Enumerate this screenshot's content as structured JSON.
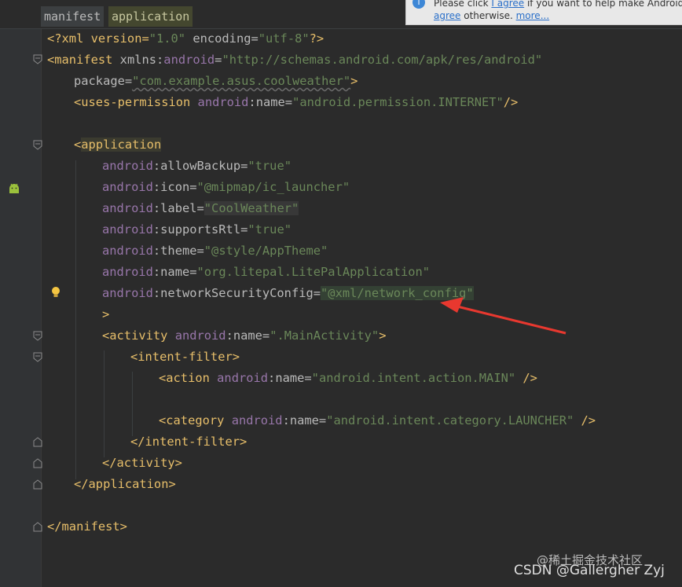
{
  "breadcrumb": [
    "manifest",
    "application"
  ],
  "notification": {
    "text_a": "Please click ",
    "link_agree": "I agree",
    "text_b": " if you want to help make Android Stud",
    "link_disagree": "agree",
    "text_c": " otherwise. ",
    "link_more": "more..."
  },
  "code": {
    "l1": {
      "open": "<?xml version=",
      "v1": "\"1.0\"",
      "mid": " encoding=",
      "v2": "\"utf-8\"",
      "close": "?>"
    },
    "l2": {
      "tag": "<manifest",
      "sp": " xmlns",
      "colon": ":",
      "ns": "android",
      "eq": "=",
      "val": "\"http://schemas.android.com/apk/res/android\""
    },
    "l3": {
      "attr": "package",
      "eq": "=",
      "val": "\"com.example.asus.coolweather\"",
      "close": ">"
    },
    "l4": {
      "tag": "<uses-permission",
      "ns": "android",
      "attr": "name",
      "val": "\"android.permission.INTERNET\"",
      "close": "/>"
    },
    "l6": {
      "lt": "<",
      "tag": "application"
    },
    "l7": {
      "ns": "android",
      "attr": "allowBackup",
      "val": "\"true\""
    },
    "l8": {
      "ns": "android",
      "attr": "icon",
      "val": "\"@mipmap/ic_launcher\""
    },
    "l9": {
      "ns": "android",
      "attr": "label",
      "val": "\"CoolWeather\""
    },
    "l10": {
      "ns": "android",
      "attr": "supportsRtl",
      "val": "\"true\""
    },
    "l11": {
      "ns": "android",
      "attr": "theme",
      "val": "\"@style/AppTheme\""
    },
    "l12": {
      "ns": "android",
      "attr": "name",
      "val": "\"org.litepal.LitePalApplication\""
    },
    "l13": {
      "ns": "android",
      "attr": "networkSecurityConfig",
      "val": "\"@xml/network_config\""
    },
    "l14": {
      "close": ">"
    },
    "l15": {
      "tag": "<activity",
      "ns": "android",
      "attr": "name",
      "val": "\".MainActivity\"",
      "close": ">"
    },
    "l16": {
      "tag": "<intent-filter>"
    },
    "l17": {
      "tag": "<action",
      "ns": "android",
      "attr": "name",
      "val": "\"android.intent.action.MAIN\"",
      "close": " />"
    },
    "l19": {
      "tag": "<category",
      "ns": "android",
      "attr": "name",
      "val": "\"android.intent.category.LAUNCHER\"",
      "close": " />"
    },
    "l20": {
      "tag": "</intent-filter>"
    },
    "l21": {
      "tag": "</activity>"
    },
    "l22": {
      "tag": "</application>"
    },
    "l24": {
      "tag": "</manifest>"
    }
  },
  "icons": {
    "gutter_android": "android-robot-icon",
    "intention": "lightbulb-icon",
    "info": "info-icon"
  },
  "annotation": {
    "arrow_color": "#e8382f"
  },
  "watermark": {
    "juejin": "@稀土掘金技术社区",
    "csdn": "CSDN @Gallergher Zyj"
  }
}
